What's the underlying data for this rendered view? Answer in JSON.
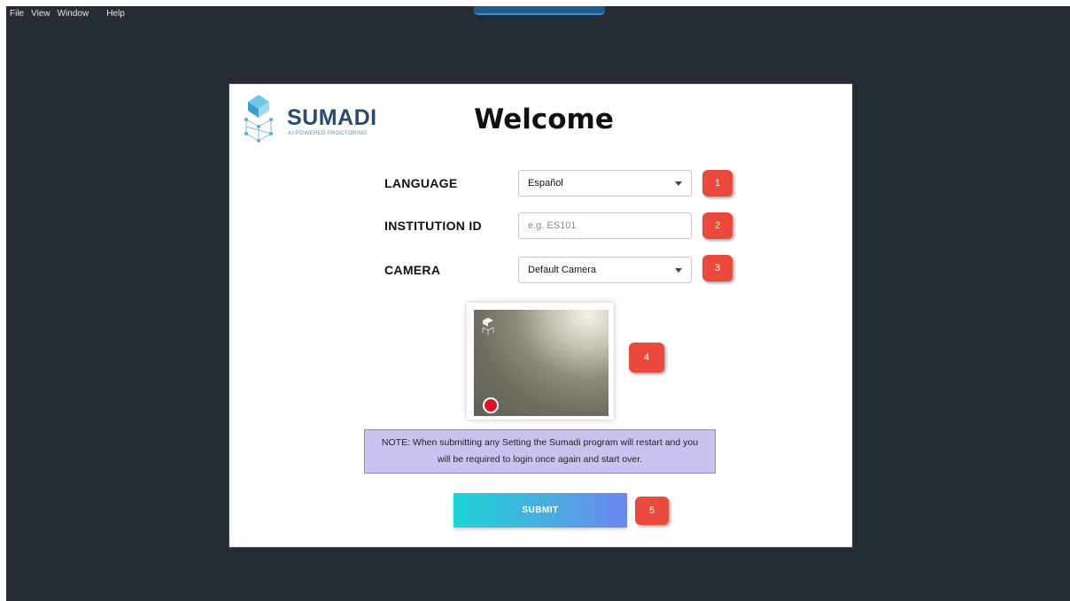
{
  "menubar": {
    "items": [
      "File",
      "View",
      "Window",
      "Help"
    ]
  },
  "logo": {
    "name": "SUMADI",
    "tagline": "AI-POWERED PROCTORING"
  },
  "welcome": "Welcome",
  "form": {
    "language": {
      "label": "LANGUAGE",
      "value": "Español",
      "badge": "1"
    },
    "institution": {
      "label": "INSTITUTION ID",
      "value": "",
      "placeholder": "e.g. ES101",
      "badge": "2"
    },
    "camera": {
      "label": "CAMERA",
      "value": "Default Camera",
      "badge": "3"
    },
    "preview_badge": "4"
  },
  "note": {
    "line1": "NOTE: When submitting any Setting the Sumadi program will restart and you",
    "line2": "will be required to login once again and start over."
  },
  "submit": {
    "label": "SUBMIT",
    "badge": "5"
  },
  "colors": {
    "background": "#262c34",
    "badge": "#ea4a3e",
    "note_bg": "#c9c4ef",
    "submit_gradient_start": "#1fd4d6",
    "submit_gradient_end": "#6d86ef"
  }
}
